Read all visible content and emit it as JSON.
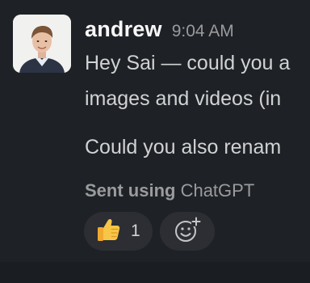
{
  "message": {
    "author": "andrew",
    "timestamp": "9:04 AM",
    "lines": [
      "Hey Sai — could you a",
      "images and videos (in",
      "Could you also renam"
    ],
    "footer_bold": "Sent using",
    "footer_app": "ChatGPT"
  },
  "reactions": [
    {
      "icon": "thumbs-up-icon",
      "count": "1"
    }
  ],
  "add_reaction": {
    "icon": "add-emoji-icon"
  },
  "colors": {
    "background": "#1a1d21",
    "message_bg": "#1e2126",
    "pill_bg": "#2c2e33",
    "author": "#f8f8f8",
    "text": "#d1d2d3",
    "muted": "#9a9b9d"
  }
}
